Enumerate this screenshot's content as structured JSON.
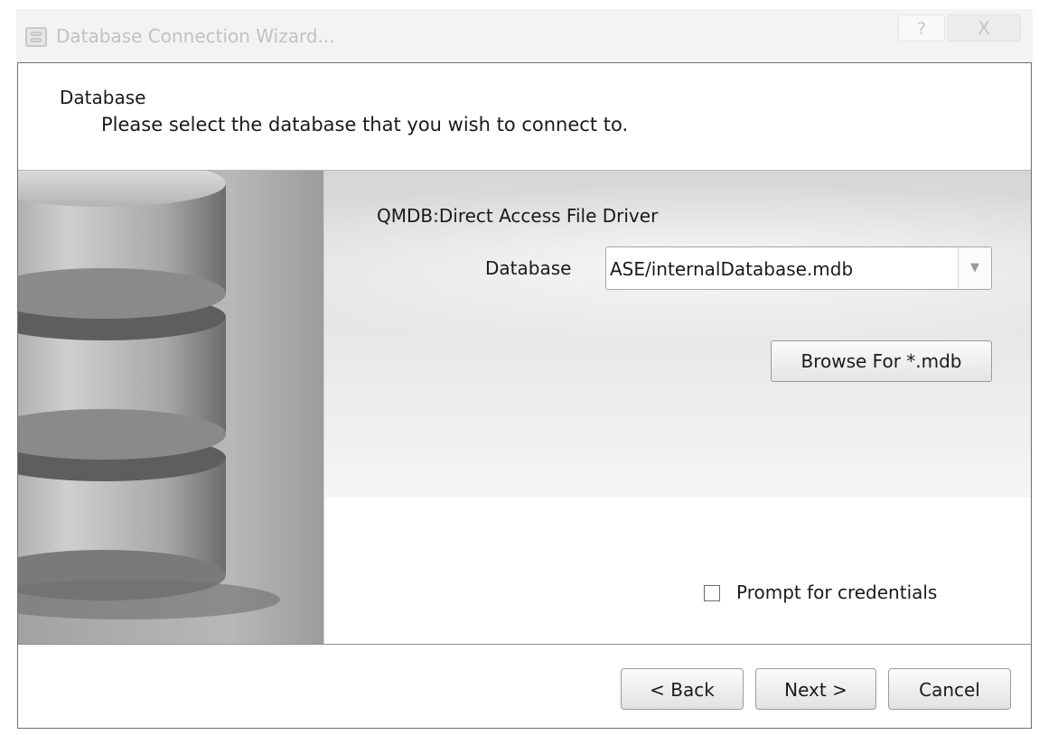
{
  "window": {
    "title": "Database Connection Wizard...",
    "help_label": "?",
    "close_label": "X"
  },
  "header": {
    "title": "Database",
    "subtitle": "Please select the database that you wish to connect to."
  },
  "banner": {
    "icon": "database-cylinder-image"
  },
  "content": {
    "driver_label": "QMDB:Direct Access File Driver",
    "database_label": "Database",
    "database_value": "ASE/internalDatabase.mdb",
    "browse_button": "Browse For *.mdb",
    "prompt_credentials_label": "Prompt for credentials",
    "prompt_credentials_checked": false
  },
  "footer": {
    "back_label": "< Back",
    "next_label": "Next >",
    "cancel_label": "Cancel"
  }
}
